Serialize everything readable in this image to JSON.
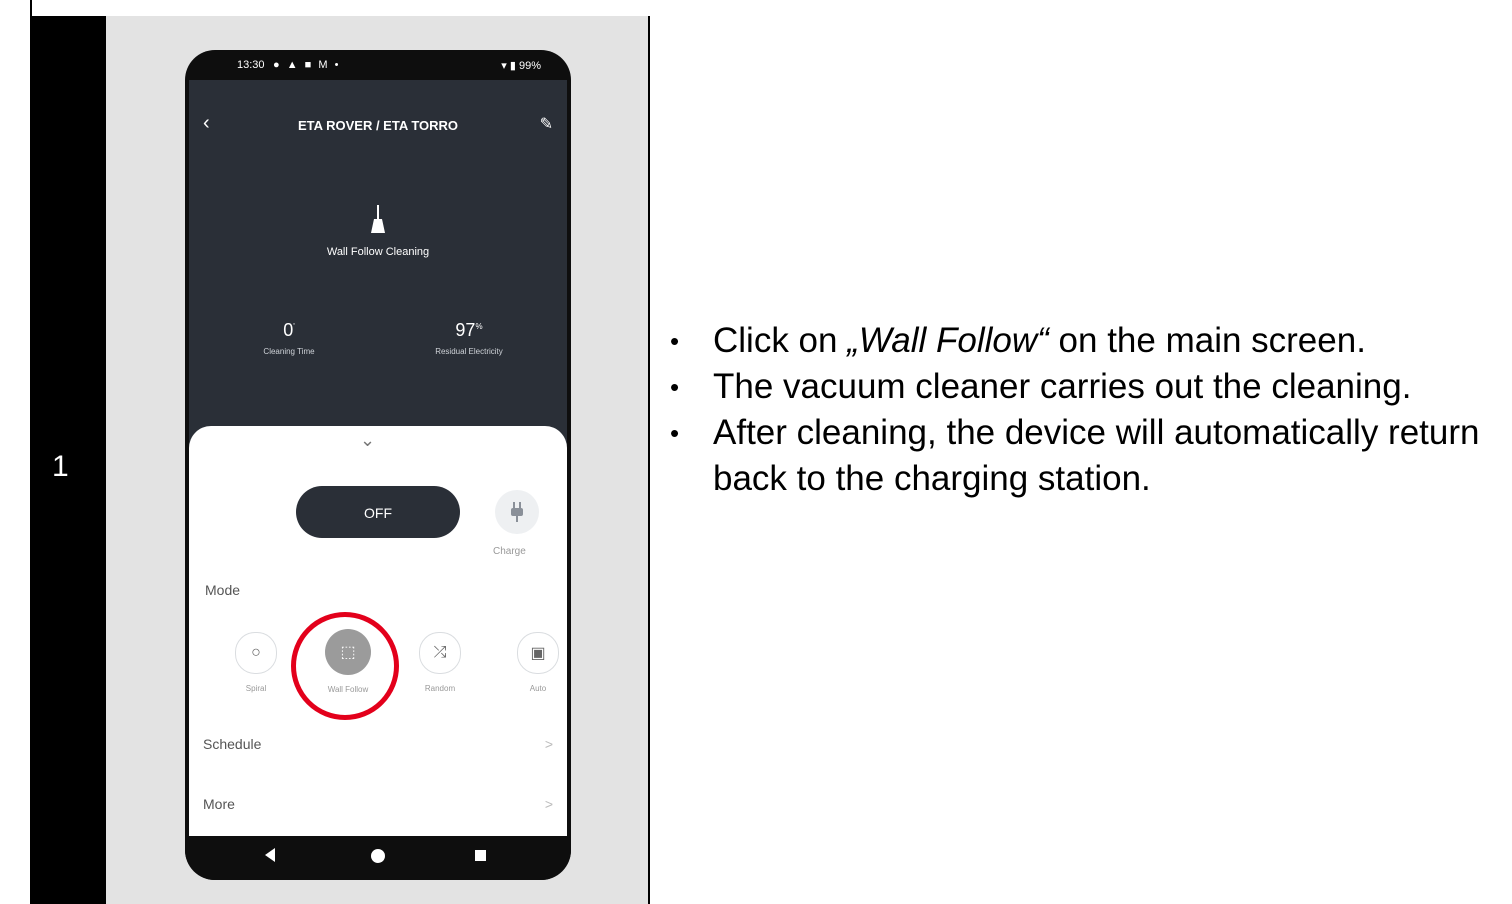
{
  "step": {
    "number": "1"
  },
  "phone": {
    "status": {
      "time": "13:30",
      "icons": "● ▲ ■ M •",
      "right": "▾ ▮ 99%"
    },
    "app_title": "ETA ROVER / ETA TORRO",
    "mode_label": "Wall Follow Cleaning",
    "stats": [
      {
        "value": "0",
        "unit": "'",
        "label": "Cleaning Time"
      },
      {
        "value": "97",
        "unit": "%",
        "label": "Residual Electricity"
      }
    ],
    "off_label": "OFF",
    "charge_label": "Charge",
    "mode_title": "Mode",
    "modes": [
      {
        "label": "Spiral",
        "icon": "○"
      },
      {
        "label": "Wall Follow",
        "icon": "⬚"
      },
      {
        "label": "Random",
        "icon": "⤮"
      },
      {
        "label": "Auto",
        "icon": "▣"
      }
    ],
    "schedule_label": "Schedule",
    "more_label": "More",
    "arrow": ">"
  },
  "instructions": [
    {
      "pre": "Click on ",
      "italic": "„Wall Follow“",
      "post": " on the main screen."
    },
    {
      "pre": "The vacuum cleaner carries out the cleaning.",
      "italic": "",
      "post": ""
    },
    {
      "pre": "After cleaning, the device will automatically return back to the charging station.",
      "italic": "",
      "post": ""
    }
  ],
  "colors": {
    "highlight": "#e3001b",
    "app_dark": "#2a2f37"
  }
}
